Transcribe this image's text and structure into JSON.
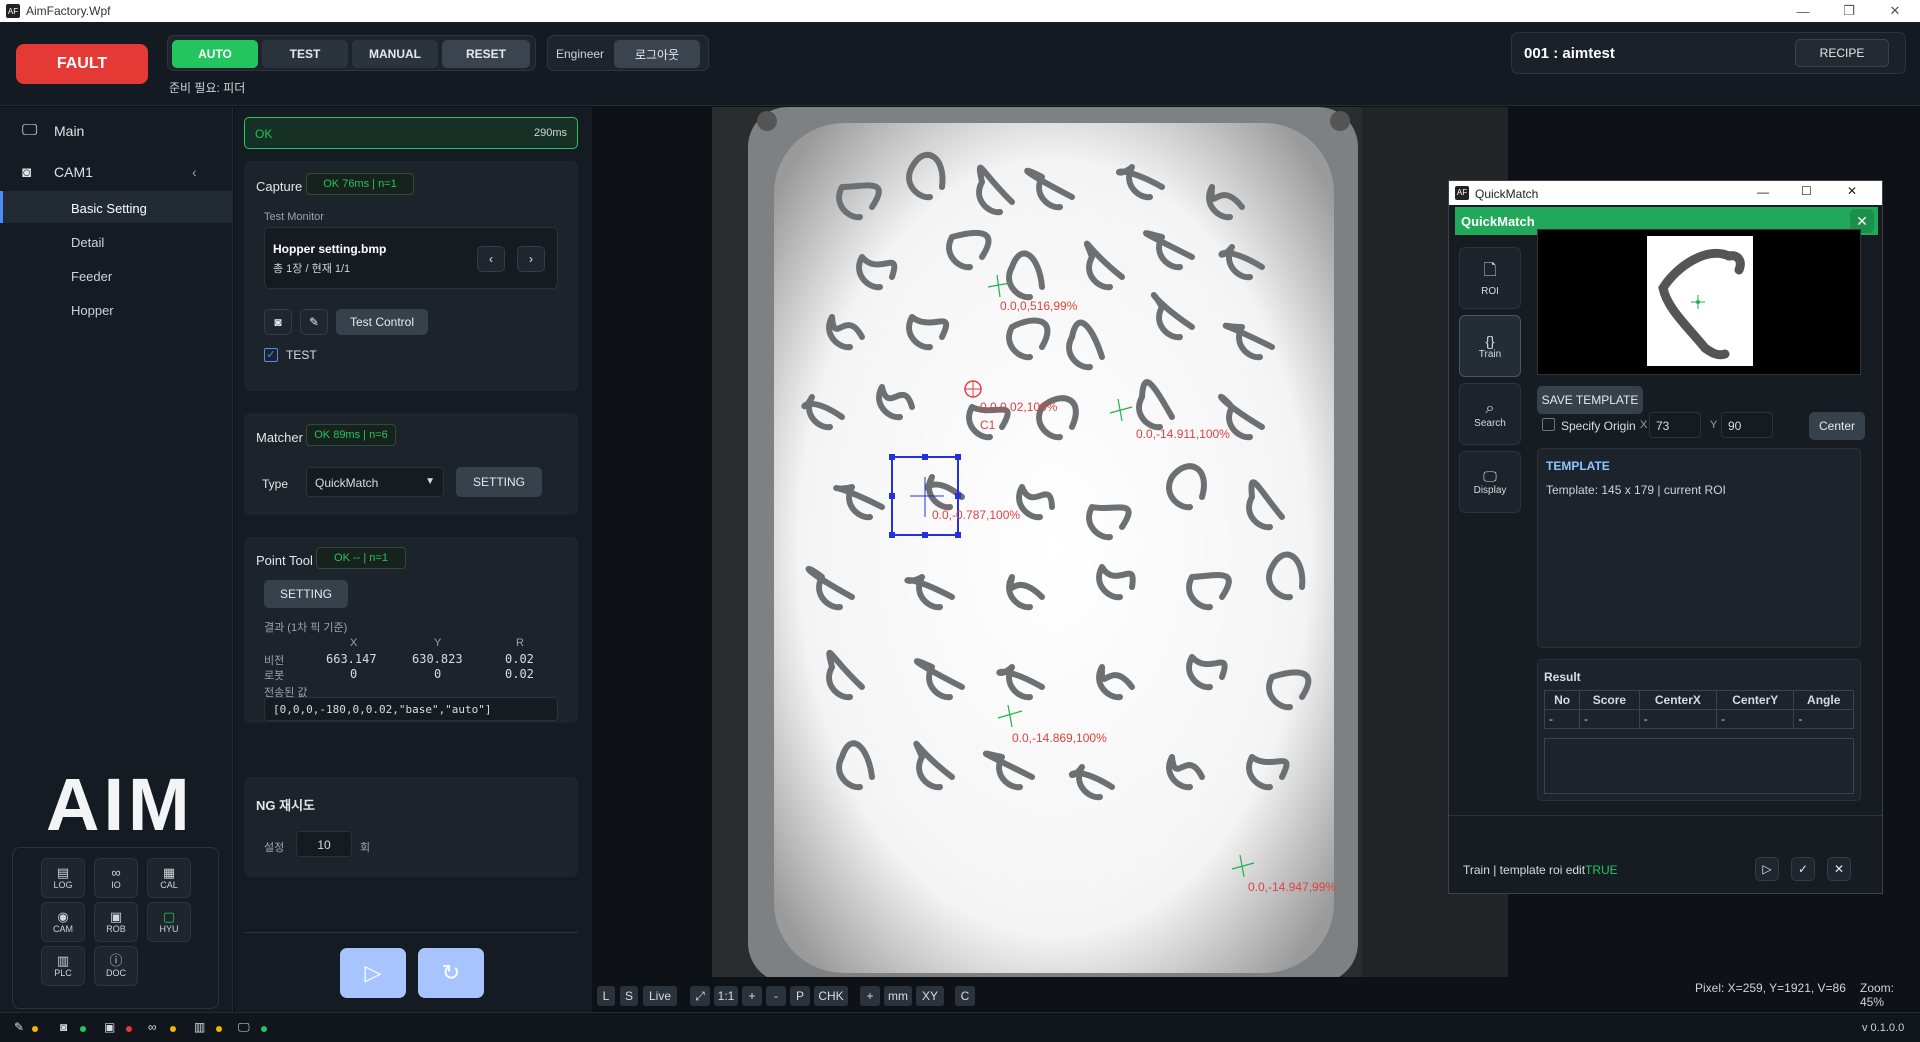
{
  "app": {
    "title": "AimFactory.Wpf",
    "logo": "AIM"
  },
  "header": {
    "fault": "FAULT",
    "modes": [
      "AUTO",
      "TEST",
      "MANUAL",
      "RESET"
    ],
    "ready_status": "준비 필요: 피더",
    "user": "Engineer",
    "logout": "로그아웃",
    "recipe": "001 : aimtest",
    "recipe_button": "RECIPE"
  },
  "sidebar": {
    "main": "Main",
    "cam": "CAM1",
    "sub": [
      "Basic Setting",
      "Detail",
      "Feeder",
      "Hopper"
    ],
    "grid": [
      {
        "ic": "▤",
        "label": "LOG"
      },
      {
        "ic": "∞",
        "label": "IO"
      },
      {
        "ic": "▦",
        "label": "CAL"
      },
      {
        "ic": "◉",
        "label": "CAM"
      },
      {
        "ic": "▣",
        "label": "ROB"
      },
      {
        "ic": "▢",
        "label": "HYU"
      },
      {
        "ic": "▥",
        "label": "PLC"
      },
      {
        "ic": "ⓘ",
        "label": "DOC"
      }
    ]
  },
  "panel": {
    "status_text": "OK",
    "status_time": "290ms",
    "capture": {
      "title": "Capture",
      "tag": "OK 76ms | n=1",
      "monitor_label": "Test Monitor",
      "file": "Hopper setting.bmp",
      "count": "총 1장 / 현재 1/1",
      "test_control": "Test Control",
      "test_check": "TEST"
    },
    "matcher": {
      "title": "Matcher",
      "tag": "OK 89ms | n=6",
      "type_label": "Type",
      "type_value": "QuickMatch",
      "setting": "SETTING"
    },
    "point": {
      "title": "Point Tool",
      "tag": "OK -- | n=1",
      "setting": "SETTING",
      "result_label": "결과 (1차 픽 기준)",
      "cols": [
        "X",
        "Y",
        "R"
      ],
      "rows": [
        {
          "name": "비전",
          "x": "663.147",
          "y": "630.823",
          "r": "0.02"
        },
        {
          "name": "로봇",
          "x": "0",
          "y": "0",
          "r": "0.02"
        }
      ],
      "sent_label": "전송된 값",
      "sent_value": "[0,0,0,-180,0,0.02,\"base\",\"auto\"]"
    },
    "retry": {
      "title": "NG 재시도",
      "label": "설정",
      "value": "10",
      "unit": "회"
    }
  },
  "overlay_labels": [
    "0.0,0,516,99%",
    "0.0,0.02,100%",
    "C1",
    "0.0,-14.911,100%",
    "0.0,-0.787,100%",
    "0.0,-14.869,100%",
    "0.0,-14.947,99%"
  ],
  "toolbar": [
    "L",
    "S",
    "Live",
    "⤢",
    "1:1",
    "+",
    "-",
    "P",
    "CHK",
    "+",
    "mm",
    "XY",
    "C"
  ],
  "pixel_info": "Pixel: X=259, Y=1921, V=86",
  "zoom": "Zoom: 45%",
  "version": "v 0.1.0.0",
  "quickmatch": {
    "window_title": "QuickMatch",
    "header": "QuickMatch",
    "tabs": [
      "ROI",
      "Train",
      "Search",
      "Display"
    ],
    "save_template": "SAVE TEMPLATE",
    "specify_origin": "Specify Origin",
    "x_label": "X",
    "x_value": "73",
    "y_label": "Y",
    "y_value": "90",
    "center": "Center",
    "template_title": "TEMPLATE",
    "template_info": "Template: 145 x 179 | current ROI",
    "result_title": "Result",
    "cols": [
      "No",
      "Score",
      "CenterX",
      "CenterY",
      "Angle"
    ],
    "row": [
      "-",
      "-",
      "-",
      "-",
      "-"
    ],
    "status": "Train | template roi edit",
    "status_value": "TRUE"
  },
  "colors": {
    "fault": "#e53935",
    "auto": "#22c55e",
    "ok": "#22c55e",
    "qm_header": "#22a85a",
    "overlay": "#e04040"
  }
}
